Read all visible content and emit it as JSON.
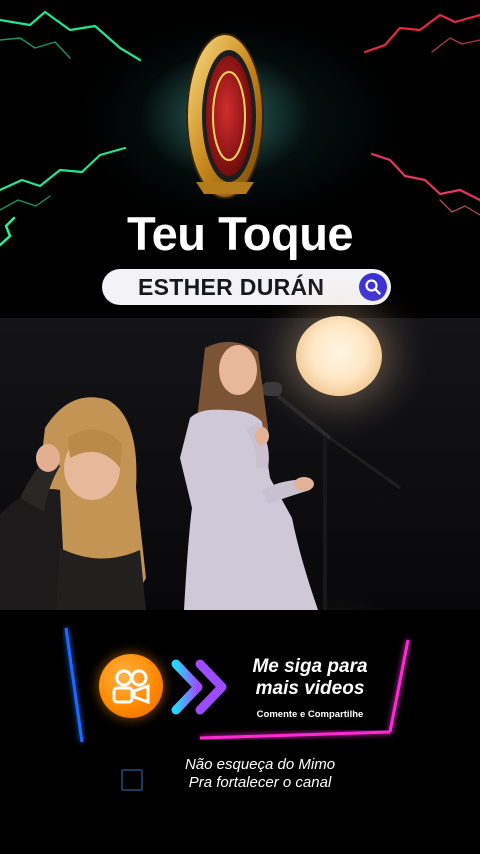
{
  "header": {
    "title": "Teu Toque",
    "logo_icon": "coin-logo-icon"
  },
  "search": {
    "value": "ESTHER DURÁN",
    "button_icon": "search-icon",
    "accent": "#3b2fd6"
  },
  "promo": {
    "app_icon": "kwai-camera-icon",
    "arrow_icon": "double-chevron-right-icon",
    "title_line1": "Me siga para",
    "title_line2": "mais videos",
    "subtitle": "Comente e Compartilhe",
    "neon_blue": "#1e6bff",
    "neon_pink": "#ff2bd6"
  },
  "footer": {
    "line1": "Não esqueça do Mimo",
    "line2": "Pra fortalecer o canal"
  }
}
